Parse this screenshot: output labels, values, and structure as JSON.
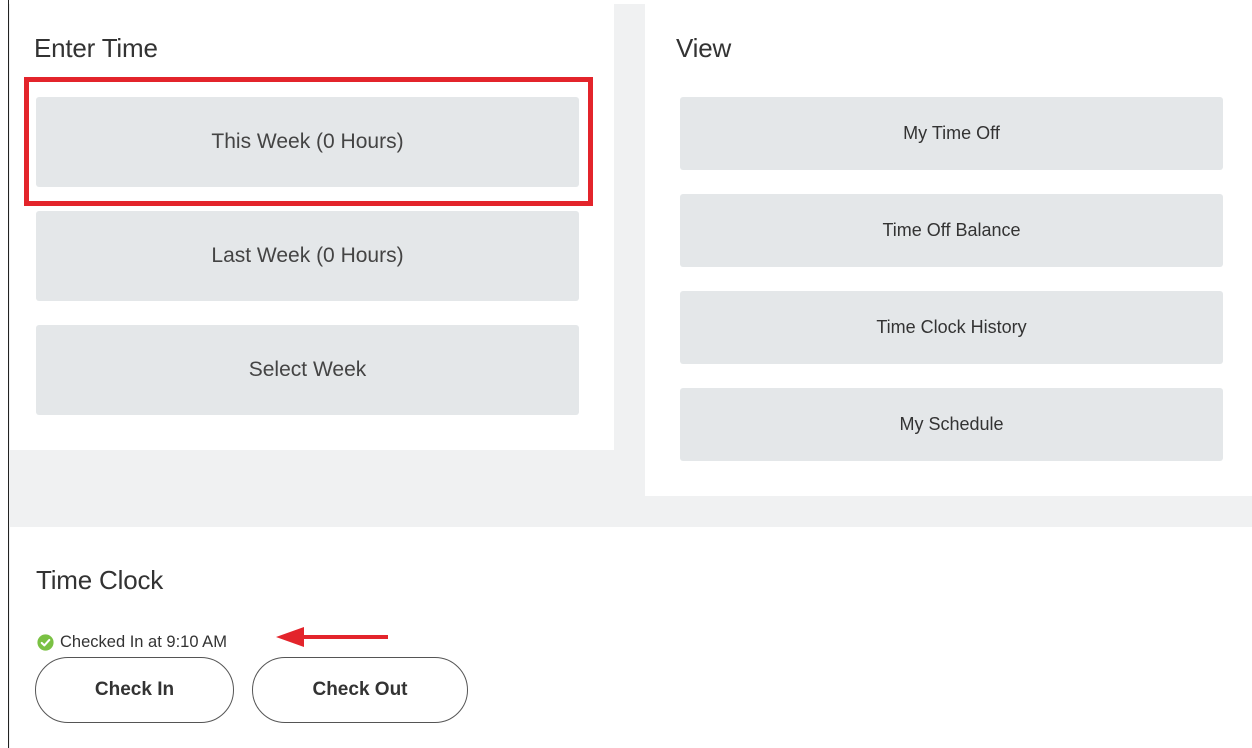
{
  "enter_time": {
    "title": "Enter Time",
    "this_week": "This Week (0 Hours)",
    "last_week": "Last Week (0 Hours)",
    "select_week": "Select Week"
  },
  "view": {
    "title": "View",
    "items": [
      "My Time Off",
      "Time Off Balance",
      "Time Clock History",
      "My Schedule"
    ]
  },
  "time_clock": {
    "title": "Time Clock",
    "status": "Checked In at 9:10 AM",
    "check_in": "Check In",
    "check_out": "Check Out"
  },
  "colors": {
    "tile": "#e4e7e9",
    "highlight": "#e3242b",
    "check_green": "#7ac143"
  },
  "icons": {
    "status": "check-circle-icon",
    "annotation": "arrow-left-icon"
  }
}
